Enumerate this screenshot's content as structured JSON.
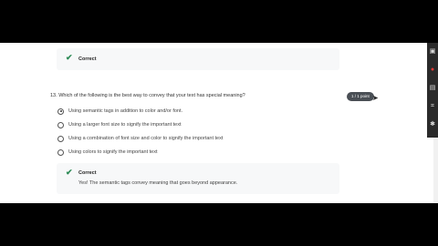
{
  "quiz": {
    "prev_feedback": {
      "status": "Correct"
    },
    "question": {
      "number_text": "13.",
      "text": "Which of the following is the best way to convey that your text has special meaning?",
      "points": "1 / 1 point",
      "options": [
        {
          "label": "Using semantic tags in addition to color and/or font.",
          "selected": true
        },
        {
          "label": "Using a larger font size to signify the important text",
          "selected": false
        },
        {
          "label": "Using a combination of font size and color to signify the important text",
          "selected": false
        },
        {
          "label": "Using colors to signify the important text",
          "selected": false
        }
      ],
      "feedback": {
        "status": "Correct",
        "text": "Yes! The semantic tags convey meaning that goes beyond appearance."
      }
    }
  },
  "icons": {
    "check": "checkmark-icon",
    "cursor": "mouse-pointer-icon",
    "side": [
      "camera-icon",
      "record-icon",
      "image-icon",
      "crop-icon",
      "settings-icon"
    ]
  },
  "colors": {
    "correct": "#2e8b57",
    "record": "#e53935",
    "badge": "#4a4f55"
  }
}
